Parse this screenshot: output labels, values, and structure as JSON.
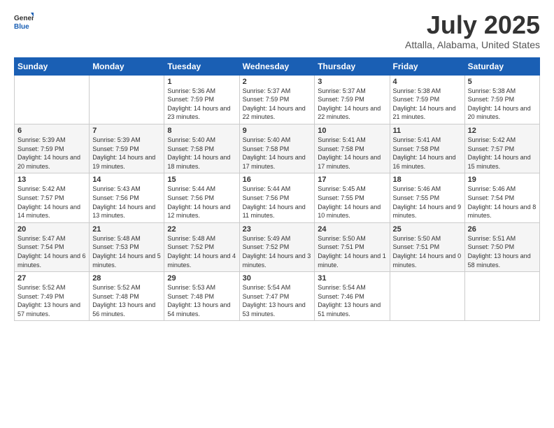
{
  "logo": {
    "general": "General",
    "blue": "Blue"
  },
  "title": {
    "month_year": "July 2025",
    "location": "Attalla, Alabama, United States"
  },
  "days_header": [
    "Sunday",
    "Monday",
    "Tuesday",
    "Wednesday",
    "Thursday",
    "Friday",
    "Saturday"
  ],
  "weeks": [
    [
      {
        "day": "",
        "info": ""
      },
      {
        "day": "",
        "info": ""
      },
      {
        "day": "1",
        "info": "Sunrise: 5:36 AM\nSunset: 7:59 PM\nDaylight: 14 hours and 23 minutes."
      },
      {
        "day": "2",
        "info": "Sunrise: 5:37 AM\nSunset: 7:59 PM\nDaylight: 14 hours and 22 minutes."
      },
      {
        "day": "3",
        "info": "Sunrise: 5:37 AM\nSunset: 7:59 PM\nDaylight: 14 hours and 22 minutes."
      },
      {
        "day": "4",
        "info": "Sunrise: 5:38 AM\nSunset: 7:59 PM\nDaylight: 14 hours and 21 minutes."
      },
      {
        "day": "5",
        "info": "Sunrise: 5:38 AM\nSunset: 7:59 PM\nDaylight: 14 hours and 20 minutes."
      }
    ],
    [
      {
        "day": "6",
        "info": "Sunrise: 5:39 AM\nSunset: 7:59 PM\nDaylight: 14 hours and 20 minutes."
      },
      {
        "day": "7",
        "info": "Sunrise: 5:39 AM\nSunset: 7:59 PM\nDaylight: 14 hours and 19 minutes."
      },
      {
        "day": "8",
        "info": "Sunrise: 5:40 AM\nSunset: 7:58 PM\nDaylight: 14 hours and 18 minutes."
      },
      {
        "day": "9",
        "info": "Sunrise: 5:40 AM\nSunset: 7:58 PM\nDaylight: 14 hours and 17 minutes."
      },
      {
        "day": "10",
        "info": "Sunrise: 5:41 AM\nSunset: 7:58 PM\nDaylight: 14 hours and 17 minutes."
      },
      {
        "day": "11",
        "info": "Sunrise: 5:41 AM\nSunset: 7:58 PM\nDaylight: 14 hours and 16 minutes."
      },
      {
        "day": "12",
        "info": "Sunrise: 5:42 AM\nSunset: 7:57 PM\nDaylight: 14 hours and 15 minutes."
      }
    ],
    [
      {
        "day": "13",
        "info": "Sunrise: 5:42 AM\nSunset: 7:57 PM\nDaylight: 14 hours and 14 minutes."
      },
      {
        "day": "14",
        "info": "Sunrise: 5:43 AM\nSunset: 7:56 PM\nDaylight: 14 hours and 13 minutes."
      },
      {
        "day": "15",
        "info": "Sunrise: 5:44 AM\nSunset: 7:56 PM\nDaylight: 14 hours and 12 minutes."
      },
      {
        "day": "16",
        "info": "Sunrise: 5:44 AM\nSunset: 7:56 PM\nDaylight: 14 hours and 11 minutes."
      },
      {
        "day": "17",
        "info": "Sunrise: 5:45 AM\nSunset: 7:55 PM\nDaylight: 14 hours and 10 minutes."
      },
      {
        "day": "18",
        "info": "Sunrise: 5:46 AM\nSunset: 7:55 PM\nDaylight: 14 hours and 9 minutes."
      },
      {
        "day": "19",
        "info": "Sunrise: 5:46 AM\nSunset: 7:54 PM\nDaylight: 14 hours and 8 minutes."
      }
    ],
    [
      {
        "day": "20",
        "info": "Sunrise: 5:47 AM\nSunset: 7:54 PM\nDaylight: 14 hours and 6 minutes."
      },
      {
        "day": "21",
        "info": "Sunrise: 5:48 AM\nSunset: 7:53 PM\nDaylight: 14 hours and 5 minutes."
      },
      {
        "day": "22",
        "info": "Sunrise: 5:48 AM\nSunset: 7:52 PM\nDaylight: 14 hours and 4 minutes."
      },
      {
        "day": "23",
        "info": "Sunrise: 5:49 AM\nSunset: 7:52 PM\nDaylight: 14 hours and 3 minutes."
      },
      {
        "day": "24",
        "info": "Sunrise: 5:50 AM\nSunset: 7:51 PM\nDaylight: 14 hours and 1 minute."
      },
      {
        "day": "25",
        "info": "Sunrise: 5:50 AM\nSunset: 7:51 PM\nDaylight: 14 hours and 0 minutes."
      },
      {
        "day": "26",
        "info": "Sunrise: 5:51 AM\nSunset: 7:50 PM\nDaylight: 13 hours and 58 minutes."
      }
    ],
    [
      {
        "day": "27",
        "info": "Sunrise: 5:52 AM\nSunset: 7:49 PM\nDaylight: 13 hours and 57 minutes."
      },
      {
        "day": "28",
        "info": "Sunrise: 5:52 AM\nSunset: 7:48 PM\nDaylight: 13 hours and 56 minutes."
      },
      {
        "day": "29",
        "info": "Sunrise: 5:53 AM\nSunset: 7:48 PM\nDaylight: 13 hours and 54 minutes."
      },
      {
        "day": "30",
        "info": "Sunrise: 5:54 AM\nSunset: 7:47 PM\nDaylight: 13 hours and 53 minutes."
      },
      {
        "day": "31",
        "info": "Sunrise: 5:54 AM\nSunset: 7:46 PM\nDaylight: 13 hours and 51 minutes."
      },
      {
        "day": "",
        "info": ""
      },
      {
        "day": "",
        "info": ""
      }
    ]
  ]
}
